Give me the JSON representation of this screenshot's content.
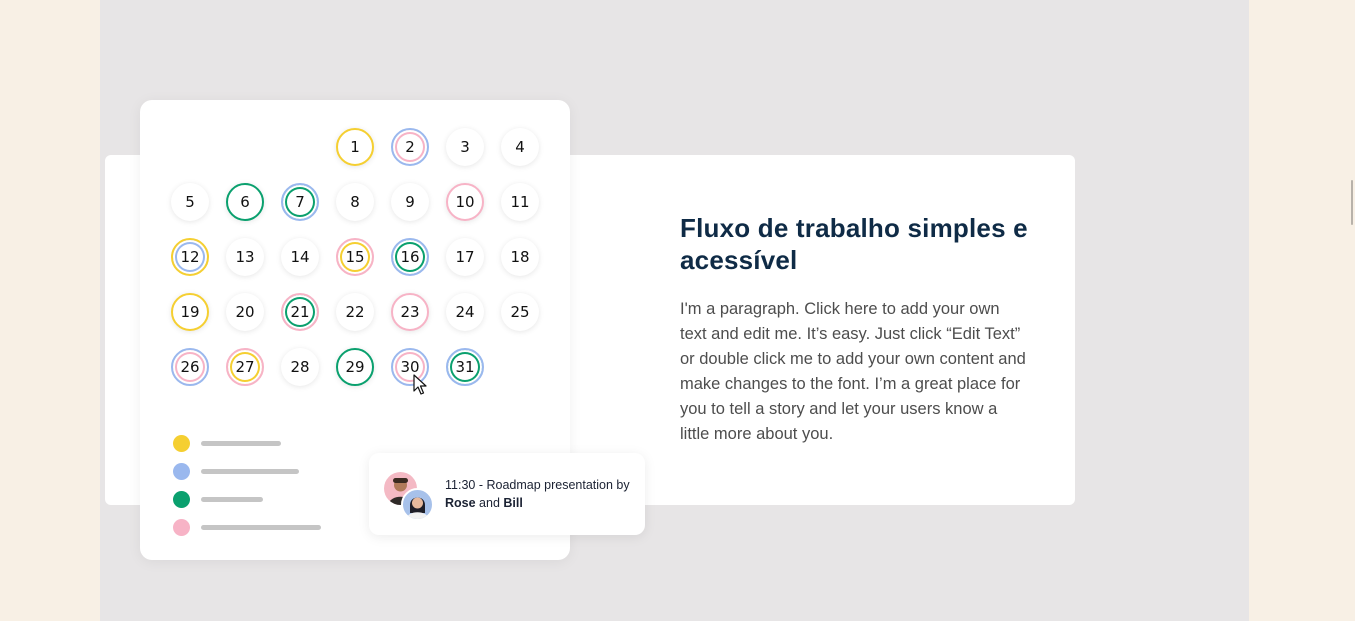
{
  "calendar": {
    "days": [
      {
        "n": "1",
        "ring": "y"
      },
      {
        "n": "2",
        "ring": "bp"
      },
      {
        "n": "3",
        "ring": ""
      },
      {
        "n": "4",
        "ring": ""
      },
      {
        "n": "5",
        "ring": ""
      },
      {
        "n": "6",
        "ring": "g"
      },
      {
        "n": "7",
        "ring": "bg"
      },
      {
        "n": "8",
        "ring": ""
      },
      {
        "n": "9",
        "ring": ""
      },
      {
        "n": "10",
        "ring": "p"
      },
      {
        "n": "11",
        "ring": ""
      },
      {
        "n": "12",
        "ring": "yb"
      },
      {
        "n": "13",
        "ring": ""
      },
      {
        "n": "14",
        "ring": ""
      },
      {
        "n": "15",
        "ring": "py"
      },
      {
        "n": "16",
        "ring": "bg"
      },
      {
        "n": "17",
        "ring": ""
      },
      {
        "n": "18",
        "ring": ""
      },
      {
        "n": "19",
        "ring": "y"
      },
      {
        "n": "20",
        "ring": ""
      },
      {
        "n": "21",
        "ring": "pg"
      },
      {
        "n": "22",
        "ring": ""
      },
      {
        "n": "23",
        "ring": "p"
      },
      {
        "n": "24",
        "ring": ""
      },
      {
        "n": "25",
        "ring": ""
      },
      {
        "n": "26",
        "ring": "bp"
      },
      {
        "n": "27",
        "ring": "py"
      },
      {
        "n": "28",
        "ring": ""
      },
      {
        "n": "29",
        "ring": "g"
      },
      {
        "n": "30",
        "ring": "bp"
      },
      {
        "n": "31",
        "ring": "bg"
      }
    ],
    "legend_colors": [
      "#f5cf31",
      "#9ab8ee",
      "#0aa06e",
      "#f7b3c6"
    ]
  },
  "event": {
    "time_text": "11:30 - Roadmap presentation by",
    "name1": "Rose",
    "and_text": " and ",
    "name2": "Bill"
  },
  "section": {
    "heading": "Fluxo de trabalho simples e acessível",
    "paragraph": "I'm a paragraph. Click here to add your own text and edit me. It’s easy. Just click “Edit Text” or double click me to add your own content and make changes to the font. I’m a great place for you to tell a story and let your users know a little more about you."
  }
}
